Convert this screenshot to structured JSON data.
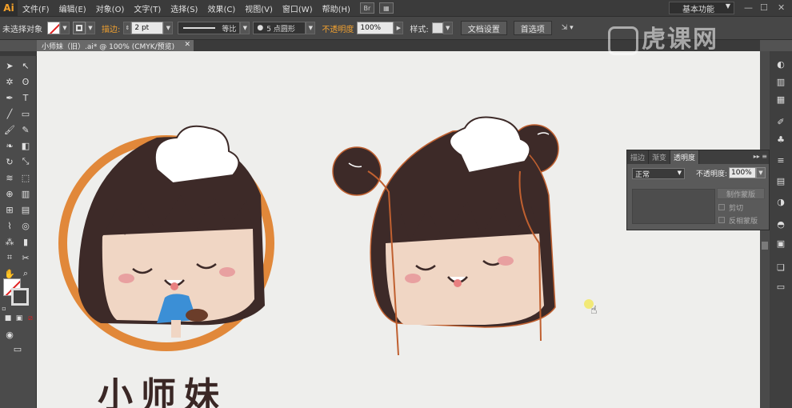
{
  "menu": {
    "logo": "Ai",
    "items": [
      "文件(F)",
      "编辑(E)",
      "对象(O)",
      "文字(T)",
      "选择(S)",
      "效果(C)",
      "视图(V)",
      "窗口(W)",
      "帮助(H)"
    ],
    "workspace": "基本功能"
  },
  "control": {
    "selection_state": "未选择对象",
    "stroke_label": "描边:",
    "stroke_value": "2 pt",
    "profile": "等比",
    "brush": "5 点圆形",
    "opacity_label": "不透明度",
    "opacity_value": "100%",
    "style_label": "样式:",
    "doc_setup": "文档设置",
    "preferences": "首选项"
  },
  "document": {
    "tab_title": "小师妹（旧）.ai* @ 100% (CMYK/预览)"
  },
  "canvas": {
    "brand_text": "小师妹"
  },
  "transparency_panel": {
    "tabs": [
      "描边",
      "渐变",
      "透明度"
    ],
    "active_tab": "透明度",
    "blend_mode": "正常",
    "opacity_label": "不透明度:",
    "opacity_value": "100%",
    "make_mask": "制作蒙版",
    "clip": "剪切",
    "invert_mask": "反相蒙版"
  },
  "watermark": "虎课网",
  "colors": {
    "accent": "#f0a030",
    "hair": "#3d2a28",
    "skin": "#f0d6c4",
    "ring": "#e1883a"
  }
}
